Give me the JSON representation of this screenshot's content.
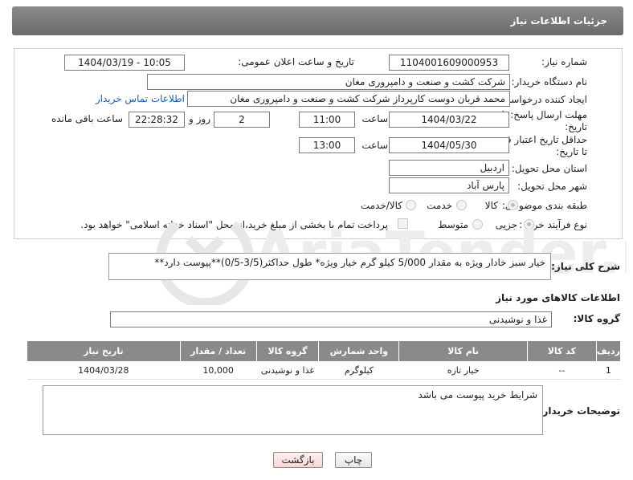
{
  "header": {
    "title": "جزئیات اطلاعات نیاز"
  },
  "form": {
    "need_number_label": "شماره نیاز:",
    "need_number": "1104001609000953",
    "announce_label": "تاریخ و ساعت اعلان عمومی:",
    "announce_value": "1404/03/19 - 10:05",
    "buyer_org_label": "نام دستگاه خریدار:",
    "buyer_org": "شرکت کشت و صنعت و دامپروری مغان",
    "creator_label": "ایجاد کننده درخواست:",
    "creator": "محمد قربان دوست کارپرداز شرکت کشت و صنعت و دامپروری مغان",
    "contact_link": "اطلاعات تماس خریدار",
    "reply_deadline_label_1": "مهلت ارسال پاسخ: تا",
    "reply_deadline_label_2": "تاریخ:",
    "reply_date": "1404/03/22",
    "time_label": "ساعت",
    "reply_time": "11:00",
    "days": "2",
    "days_label": "روز و",
    "remaining": "22:28:32",
    "remaining_label": "ساعت باقی مانده",
    "price_validity_label_1": "حداقل تاریخ اعتبار قیمت:",
    "price_validity_label_2": "تا تاریخ:",
    "price_date": "1404/05/30",
    "price_time": "13:00",
    "province_label": "استان محل تحویل:",
    "province": "اردبیل",
    "city_label": "شهر محل تحویل:",
    "city": "پارس آباد",
    "category_label": "طبقه بندی موضوعی:",
    "category_options": [
      "کالا",
      "خدمت",
      "کالا/خدمت"
    ],
    "category_selected": "کالا",
    "process_label": "نوع فرآیند خرید :",
    "process_options": [
      "جزیی",
      "متوسط"
    ],
    "process_selected": "جزیی",
    "payment_note": "پرداخت تمام یا بخشی از مبلغ خرید،از محل \"اسناد خزانه اسلامی\" خواهد بود."
  },
  "description": {
    "label": "شرح کلی نیاز:",
    "text": "خیار سبز خادار ویژه به مقدار 5/000 کیلو گرم خیار ویژه* طول حداکثر(3/5-0/5)**پیوست دارد**"
  },
  "goods_info_title": "اطلاعات کالاهای مورد نیاز",
  "goods_group": {
    "label": "گروه کالا:",
    "value": "غذا و نوشیدنی"
  },
  "table": {
    "headers": [
      "ردیف",
      "کد کالا",
      "نام کالا",
      "واحد شمارش",
      "گروه کالا",
      "تعداد / مقدار",
      "تاریخ نیاز"
    ],
    "rows": [
      [
        "1",
        "--",
        "خیار تازه",
        "کیلوگرم",
        "غذا و نوشیدنی",
        "10,000",
        "1404/03/28"
      ]
    ]
  },
  "buyer_notes": {
    "label": "توضیحات خریدار:",
    "text": "شرایط خرید پیوست می باشد"
  },
  "buttons": {
    "print": "چاپ",
    "back": "بازگشت"
  },
  "watermark": {
    "text": "AriaTender.neT"
  },
  "colors": {
    "header_bg": "#7a7a7a",
    "link": "#1a5fb4",
    "table_header": "#8a8a8a",
    "back_button": "#f7d6d6"
  }
}
